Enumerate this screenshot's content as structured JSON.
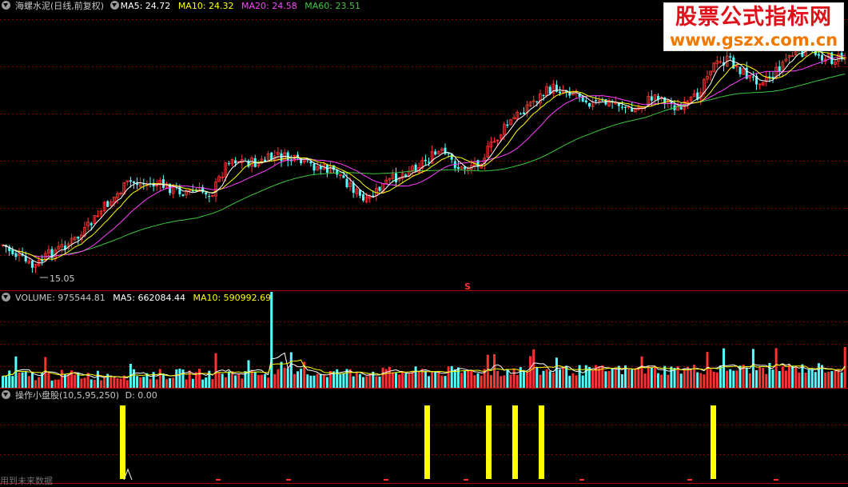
{
  "main_panel": {
    "title": "海螺水泥(日线,前复权)",
    "ma5": "MA5: 24.72",
    "ma10": "MA10: 24.32",
    "ma20": "MA20: 24.58",
    "ma60": "MA60: 23.51",
    "low_price_label": "15.05",
    "marker_label": "S"
  },
  "volume_panel": {
    "label": "VOLUME: 975544.81",
    "ma5": "MA5: 662084.44",
    "ma10": "MA10: 590992.69"
  },
  "indicator_panel": {
    "label": "操作小盘股(10,5,95,250)",
    "d_value": "D: 0.00"
  },
  "logo": {
    "line1": "股票公式指标网",
    "line2": "www.gszx.com.cn"
  },
  "watermark": "用到未来数据",
  "colors": {
    "up": "#ff3232",
    "down": "#54ffff",
    "ma5": "#ffffff",
    "ma10": "#ffff00",
    "ma20": "#ff40ff",
    "ma60": "#3cc83c",
    "signal": "#ffff00",
    "grid": "#8b0000"
  },
  "chart_data": {
    "type": "candlestick",
    "price_low": 15.05,
    "ma_latest": {
      "MA5": 24.72,
      "MA10": 24.32,
      "MA20": 24.58,
      "MA60": 23.51
    },
    "volume_latest": {
      "VOLUME": 975544.81,
      "MA5": 662084.44,
      "MA10": 590992.69
    },
    "indicator_signal_bars": 6
  }
}
